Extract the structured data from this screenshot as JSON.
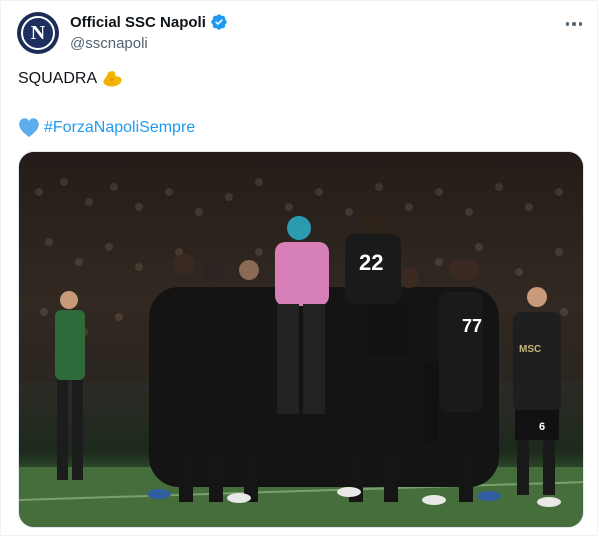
{
  "account": {
    "display_name": "Official SSC Napoli",
    "handle": "@sscnapoli",
    "verified": true,
    "avatar_letter": "N",
    "verified_color": "#1d9bf0"
  },
  "tweet": {
    "line1_text": "SQUADRA",
    "line1_emoji": "flexed-biceps",
    "line2_emoji": "light-blue-heart",
    "hashtag": "#ForzaNapoliSempre",
    "hashtag_color": "#1d9bf0"
  },
  "media": {
    "player_numbers": [
      "22",
      "77",
      "6"
    ],
    "shirt_text": "MSC"
  }
}
